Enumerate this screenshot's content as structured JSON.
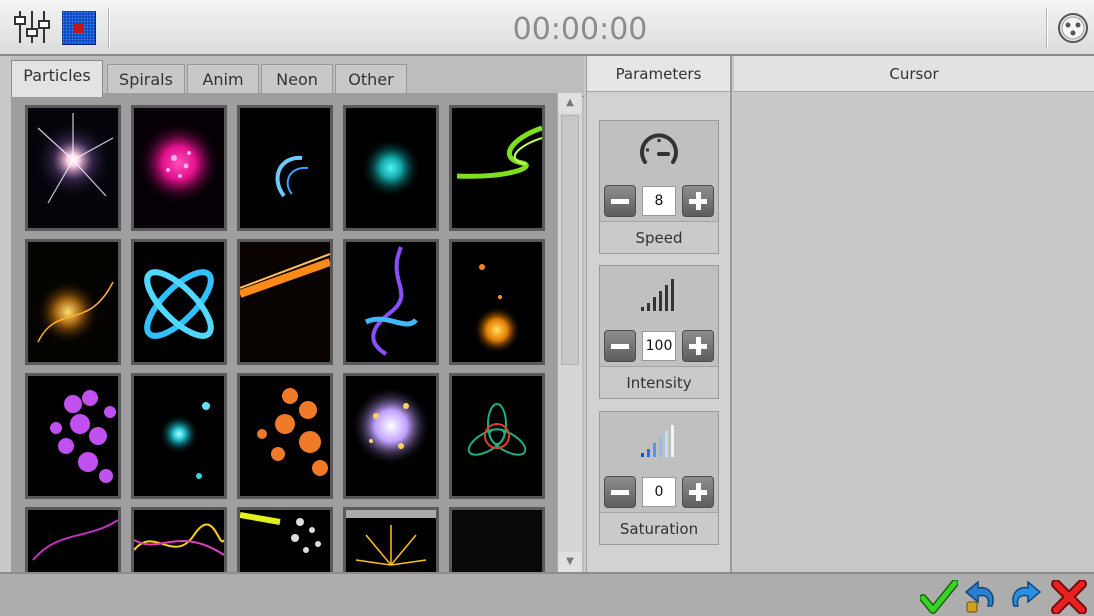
{
  "toolbar": {
    "timer": "00:00:00",
    "icons": [
      "sliders-icon",
      "led-matrix-icon",
      "dmx-connector-icon"
    ]
  },
  "tabs": [
    {
      "label": "Particles",
      "active": true
    },
    {
      "label": "Spirals",
      "active": false
    },
    {
      "label": "Anim",
      "active": false
    },
    {
      "label": "Neon",
      "active": false
    },
    {
      "label": "Other",
      "active": false
    }
  ],
  "parameters": {
    "header": "Parameters",
    "items": [
      {
        "label": "Speed",
        "value": "8",
        "icon": "speedometer-icon"
      },
      {
        "label": "Intensity",
        "value": "100",
        "icon": "signal-bars-icon"
      },
      {
        "label": "Saturation",
        "value": "0",
        "icon": "color-bars-icon"
      }
    ]
  },
  "cursor": {
    "header": "Cursor"
  },
  "bottom": {
    "icons": [
      "confirm-check-icon",
      "undo-icon",
      "redo-icon",
      "cancel-x-icon"
    ]
  },
  "colors": {
    "accent_green": "#2bb21a",
    "accent_red": "#e02020",
    "accent_blue": "#3a8fd8",
    "timer_gray": "#8c8c8c"
  }
}
